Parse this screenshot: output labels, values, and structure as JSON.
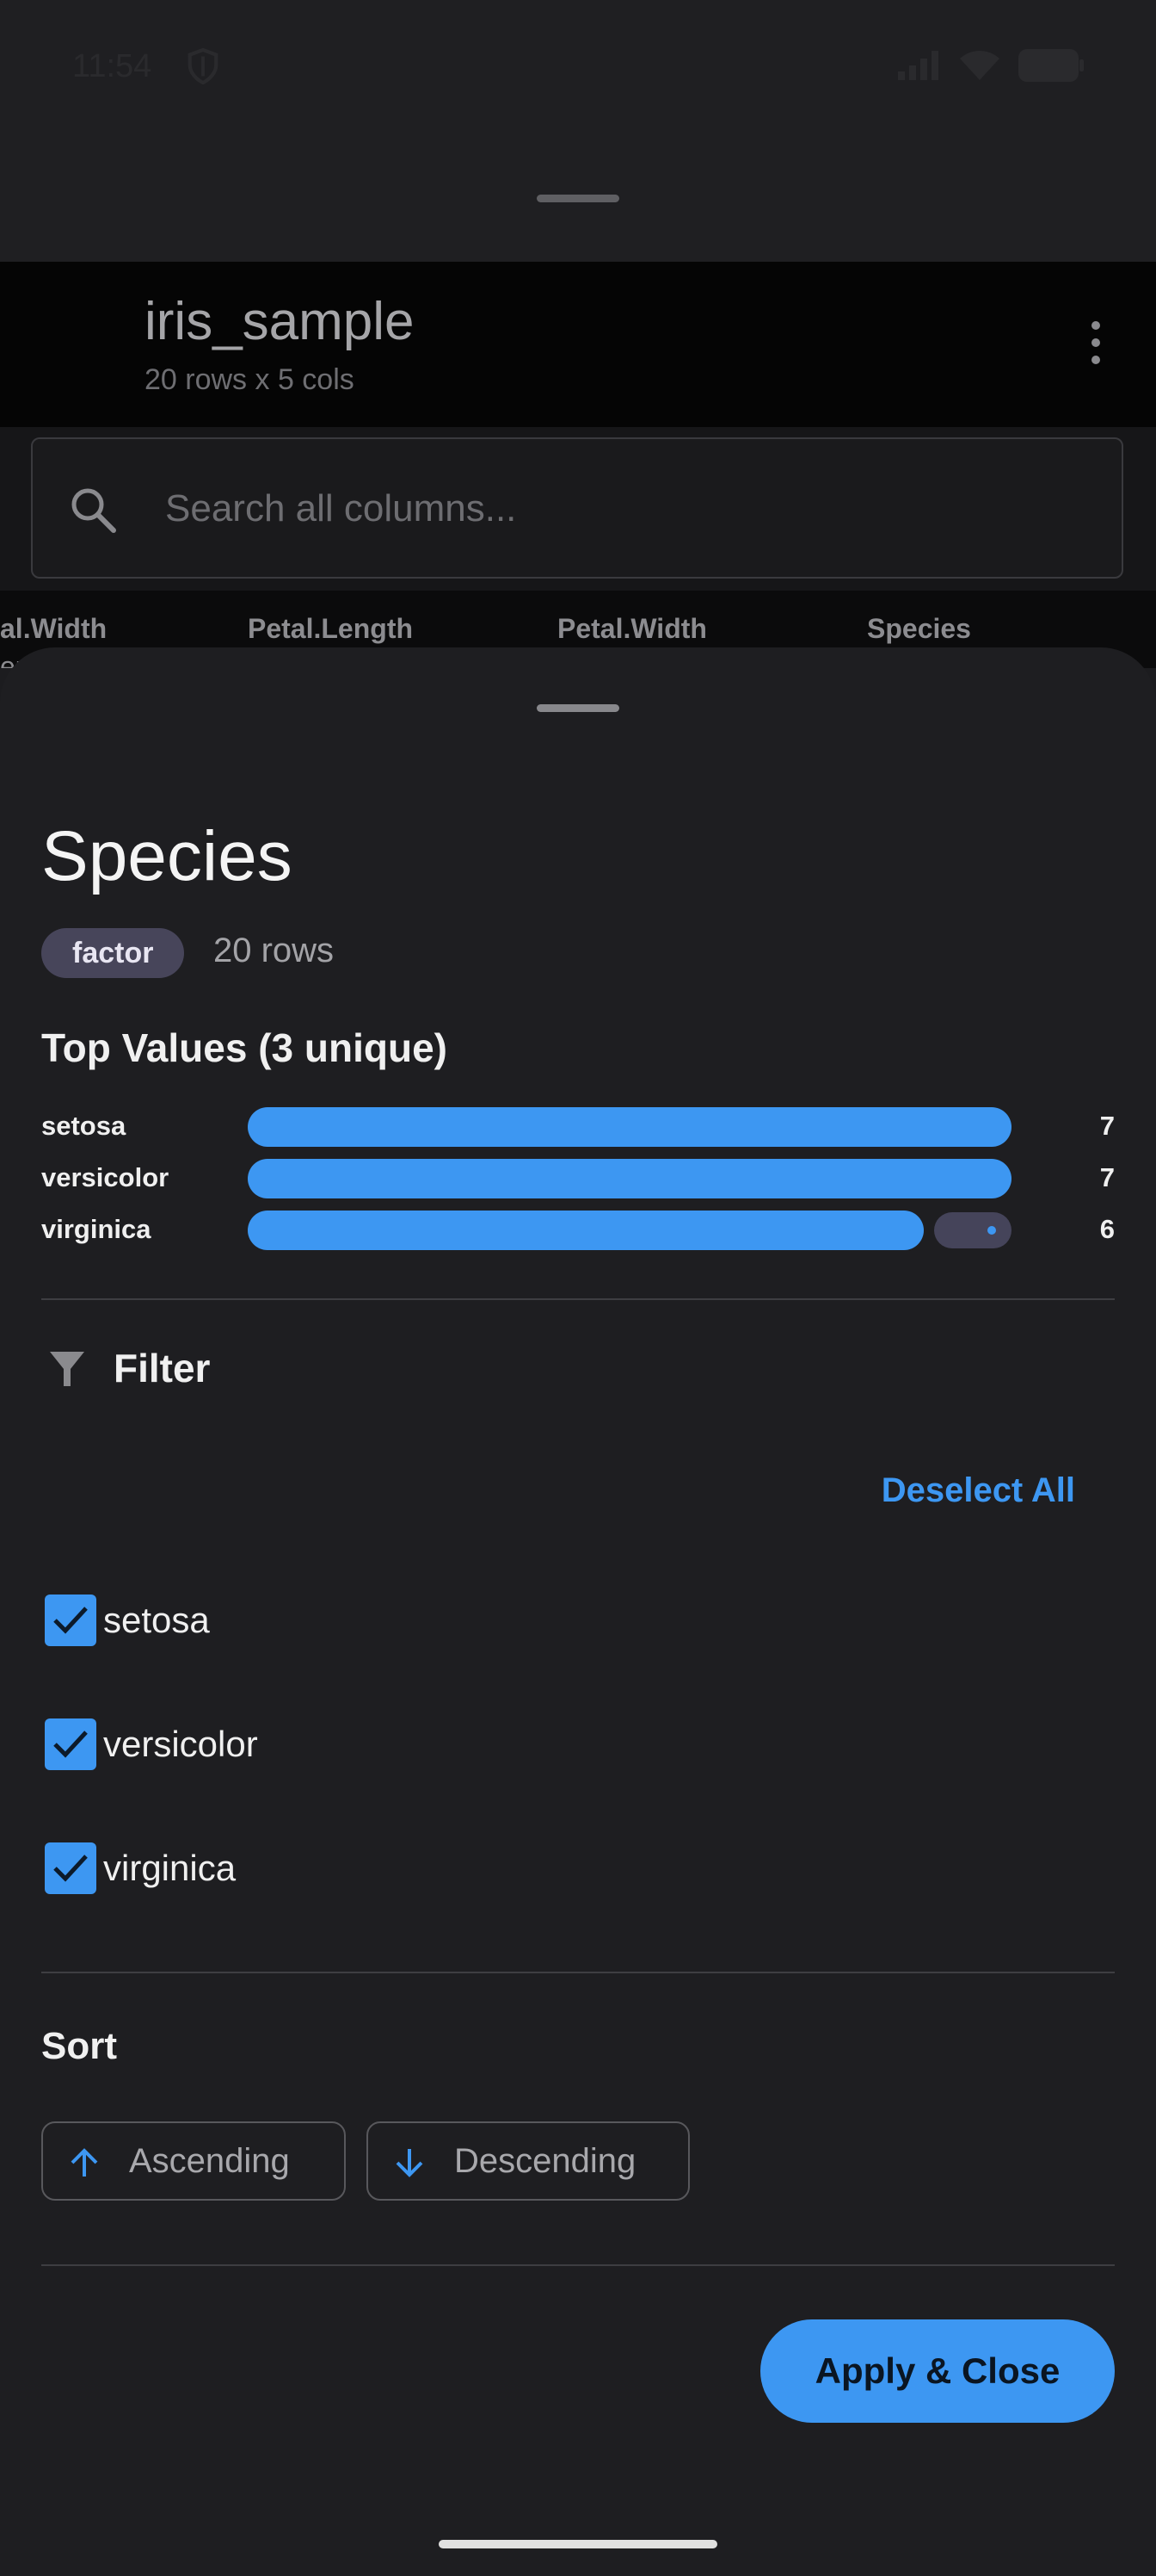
{
  "status": {
    "time": "11:54"
  },
  "dataset": {
    "title": "iris_sample",
    "subtitle": "20 rows x 5 cols"
  },
  "search": {
    "placeholder": "Search all columns..."
  },
  "columns": [
    "al.Width",
    "Petal.Length",
    "Petal.Width",
    "Species"
  ],
  "partial_row": "eri",
  "sheet": {
    "column_name": "Species",
    "type_chip": "factor",
    "row_count": "20 rows",
    "top_values_title": "Top Values (3 unique)",
    "top_values": [
      {
        "label": "setosa",
        "count": "7",
        "fraction": 1.0
      },
      {
        "label": "versicolor",
        "count": "7",
        "fraction": 1.0
      },
      {
        "label": "virginica",
        "count": "6",
        "fraction": 0.857
      }
    ],
    "filter_title": "Filter",
    "deselect_all": "Deselect All",
    "filter_options": [
      {
        "label": "setosa",
        "checked": true
      },
      {
        "label": "versicolor",
        "checked": true
      },
      {
        "label": "virginica",
        "checked": true
      }
    ],
    "sort_title": "Sort",
    "sort_ascending": "Ascending",
    "sort_descending": "Descending",
    "apply_button": "Apply & Close"
  },
  "colors": {
    "accent": "#3d97f2",
    "sheet_bg": "#1e1e21",
    "chip_bg": "#47455a"
  }
}
